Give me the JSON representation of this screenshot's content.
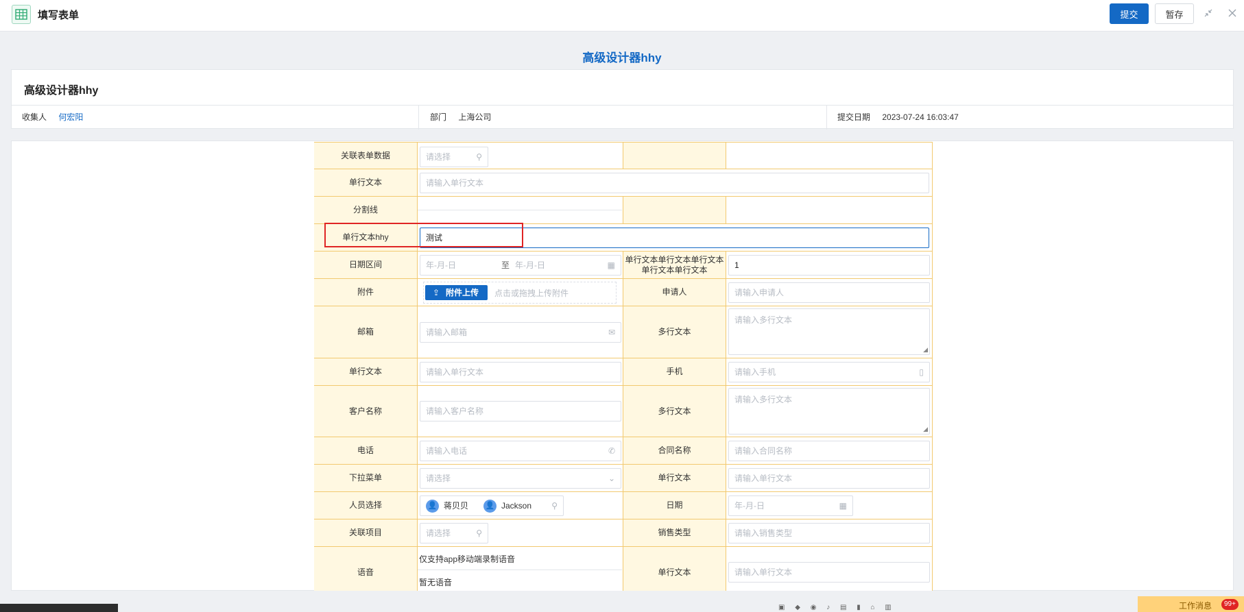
{
  "window": {
    "title": "填写表单",
    "submit_label": "提交",
    "save_label": "暂存",
    "icons": [
      "table-app-icon",
      "minimize-icon",
      "close-icon"
    ]
  },
  "form": {
    "title": "高级设计器hhy",
    "card_title": "高级设计器hhy",
    "collector_label": "收集人",
    "collector_value": "何宏阳",
    "department_label": "部门",
    "department_value": "上海公司",
    "submit_date_label": "提交日期",
    "submit_date_value": "2023-07-24 16:03:47"
  },
  "fields": {
    "related_form": {
      "label": "关联表单数据",
      "placeholder": "请选择"
    },
    "single_text_1": {
      "label": "单行文本",
      "placeholder": "请输入单行文本"
    },
    "divider": {
      "label": "分割线"
    },
    "single_text_hhy": {
      "label": "单行文本hhy",
      "value": "测试"
    },
    "date_range": {
      "label": "日期区间",
      "start_placeholder": "年-月-日",
      "separator": "至",
      "end_placeholder": "年-月-日"
    },
    "long_label_text": {
      "label_line1": "单行文本单行文本单行文本",
      "label_line2": "单行文本单行文本",
      "value": "1"
    },
    "attachment": {
      "label": "附件",
      "button": "附件上传",
      "hint": "点击或拖拽上传附件"
    },
    "applicant": {
      "label": "申请人",
      "placeholder": "请输入申请人"
    },
    "email": {
      "label": "邮箱",
      "placeholder": "请输入邮箱"
    },
    "multiline_1": {
      "label": "多行文本",
      "placeholder": "请输入多行文本"
    },
    "single_text_2": {
      "label": "单行文本",
      "placeholder": "请输入单行文本"
    },
    "mobile": {
      "label": "手机",
      "placeholder": "请输入手机"
    },
    "customer": {
      "label": "客户名称",
      "placeholder": "请输入客户名称"
    },
    "multiline_2": {
      "label": "多行文本",
      "placeholder": "请输入多行文本"
    },
    "phone": {
      "label": "电话",
      "placeholder": "请输入电话"
    },
    "contract": {
      "label": "合同名称",
      "placeholder": "请输入合同名称"
    },
    "dropdown": {
      "label": "下拉菜单",
      "placeholder": "请选择"
    },
    "single_text_3": {
      "label": "单行文本",
      "placeholder": "请输入单行文本"
    },
    "people": {
      "label": "人员选择",
      "person1": "蒋贝贝",
      "person2": "Jackson"
    },
    "date": {
      "label": "日期",
      "placeholder": "年-月-日"
    },
    "project": {
      "label": "关联项目",
      "placeholder": "请选择"
    },
    "sales_type": {
      "label": "销售类型",
      "placeholder": "请输入销售类型"
    },
    "voice": {
      "label": "语音",
      "note": "仅支持app移动端录制语音",
      "empty": "暂无语音"
    },
    "single_text_4": {
      "label": "单行文本",
      "placeholder": "请输入单行文本"
    }
  },
  "notice": {
    "text": "工作消息",
    "badge": "99+"
  },
  "colors": {
    "accent": "#1469c5",
    "label_bg": "#fff8e1",
    "grid_line": "#f2c96f",
    "highlight": "#e02424"
  }
}
